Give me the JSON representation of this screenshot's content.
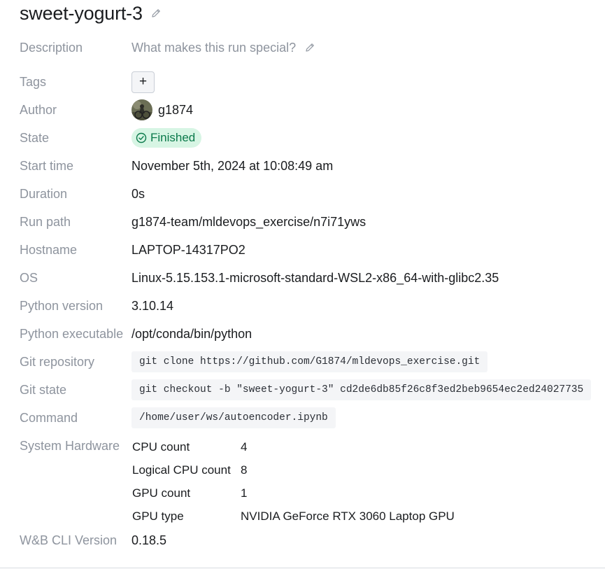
{
  "run": {
    "name": "sweet-yogurt-3"
  },
  "overview": {
    "description": {
      "label": "Description",
      "placeholder": "What makes this run special?"
    },
    "tags": {
      "label": "Tags",
      "add_label": "+"
    },
    "author": {
      "label": "Author",
      "username": "g1874"
    },
    "state": {
      "label": "State",
      "value": "Finished",
      "color": "#0b7a4b",
      "background": "#d7f5e4"
    },
    "start_time": {
      "label": "Start time",
      "value": "November 5th, 2024 at 10:08:49 am"
    },
    "duration": {
      "label": "Duration",
      "value": "0s"
    },
    "run_path": {
      "label": "Run path",
      "value": "g1874-team/mldevops_exercise/n7i71yws"
    },
    "hostname": {
      "label": "Hostname",
      "value": "LAPTOP-14317PO2"
    },
    "os": {
      "label": "OS",
      "value": "Linux-5.15.153.1-microsoft-standard-WSL2-x86_64-with-glibc2.35"
    },
    "python_version": {
      "label": "Python version",
      "value": "3.10.14"
    },
    "python_executable": {
      "label": "Python executable",
      "value": "/opt/conda/bin/python"
    },
    "git_repository": {
      "label": "Git repository",
      "value": "git clone https://github.com/G1874/mldevops_exercise.git"
    },
    "git_state": {
      "label": "Git state",
      "value": "git checkout -b \"sweet-yogurt-3\" cd2de6db85f26c8f3ed2beb9654ec2ed24027735"
    },
    "command": {
      "label": "Command",
      "value": "/home/user/ws/autoencoder.ipynb"
    },
    "system_hardware": {
      "label": "System Hardware",
      "rows": [
        {
          "key": "CPU count",
          "value": "4"
        },
        {
          "key": "Logical CPU count",
          "value": "8"
        },
        {
          "key": "GPU count",
          "value": "1"
        },
        {
          "key": "GPU type",
          "value": "NVIDIA GeForce RTX 3060 Laptop GPU"
        }
      ]
    },
    "cli_version": {
      "label": "W&B CLI Version",
      "value": "0.18.5"
    }
  },
  "icons": {
    "edit": "pencil-icon",
    "state": "check-circle-icon"
  }
}
